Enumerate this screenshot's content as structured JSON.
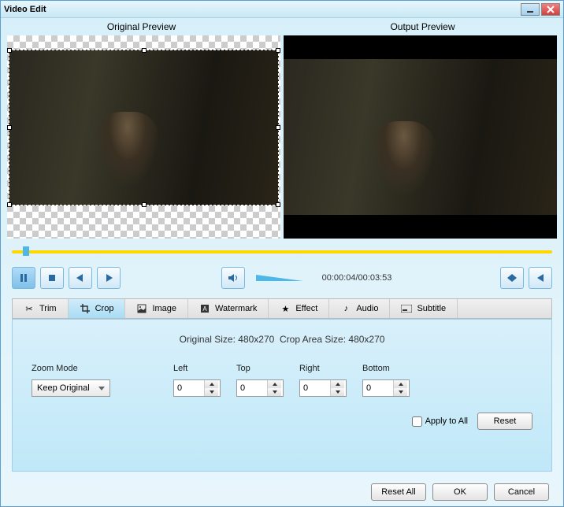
{
  "title": "Video Edit",
  "previews": {
    "original": "Original Preview",
    "output": "Output Preview"
  },
  "time": {
    "current": "00:00:04",
    "total": "00:03:53"
  },
  "tabs": [
    {
      "label": "Trim",
      "icon": "scissors"
    },
    {
      "label": "Crop",
      "icon": "crop"
    },
    {
      "label": "Image",
      "icon": "image"
    },
    {
      "label": "Watermark",
      "icon": "watermark"
    },
    {
      "label": "Effect",
      "icon": "star"
    },
    {
      "label": "Audio",
      "icon": "note"
    },
    {
      "label": "Subtitle",
      "icon": "subtitle"
    }
  ],
  "active_tab": "Crop",
  "crop_panel": {
    "original_size_label": "Original Size:",
    "original_size": "480x270",
    "crop_area_label": "Crop Area Size:",
    "crop_area": "480x270",
    "zoom_mode_label": "Zoom Mode",
    "zoom_mode_value": "Keep Original",
    "left_label": "Left",
    "left_value": "0",
    "top_label": "Top",
    "top_value": "0",
    "right_label": "Right",
    "right_value": "0",
    "bottom_label": "Bottom",
    "bottom_value": "0",
    "apply_to_all_label": "Apply to All",
    "apply_to_all_checked": false,
    "reset_label": "Reset"
  },
  "footer": {
    "reset_all": "Reset All",
    "ok": "OK",
    "cancel": "Cancel"
  }
}
